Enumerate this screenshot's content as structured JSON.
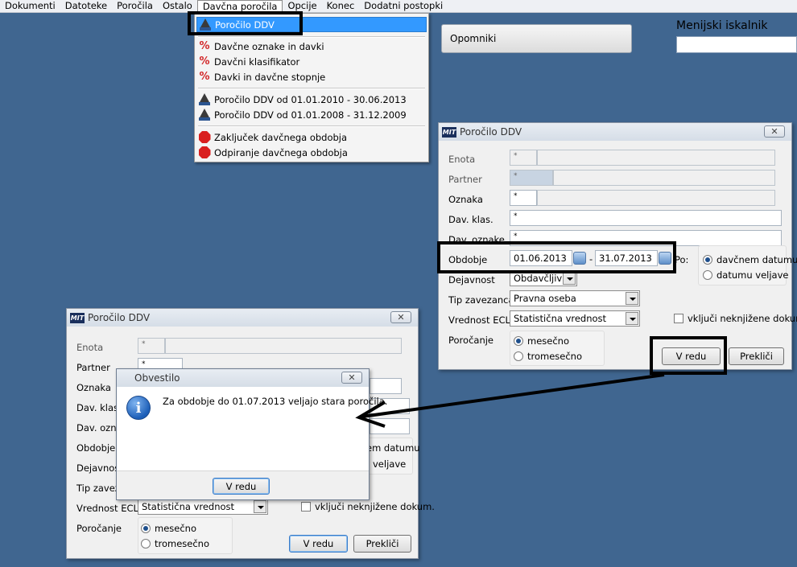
{
  "menu": {
    "items": [
      {
        "label": "Dokumenti"
      },
      {
        "label": "Datoteke"
      },
      {
        "label": "Poročila"
      },
      {
        "label": "Ostalo"
      },
      {
        "label": "Davčna poročila"
      },
      {
        "label": "Opcije"
      },
      {
        "label": "Konec"
      },
      {
        "label": "Dodatni postopki"
      }
    ]
  },
  "dropdown": {
    "items": [
      {
        "label": "Poročilo DDV",
        "icon": "durs-icon"
      },
      {
        "label": "Davčne oznake in davki",
        "icon": "percent-icon"
      },
      {
        "label": "Davčni klasifikator",
        "icon": "percent-icon"
      },
      {
        "label": "Davki in davčne stopnje",
        "icon": "percent-icon"
      },
      {
        "label": "Poročilo DDV od 01.01.2010 - 30.06.2013",
        "icon": "durs-icon"
      },
      {
        "label": "Poročilo DDV od 01.01.2008 - 31.12.2009",
        "icon": "durs-icon"
      },
      {
        "label": "Zaključek davčnega obdobja",
        "icon": "stop-icon"
      },
      {
        "label": "Odpiranje davčnega obdobja",
        "icon": "stop-icon"
      }
    ],
    "icon_text": {
      "durs": "DURS",
      "stop": "STOP"
    }
  },
  "opomniki_label": "Opomniki",
  "search": {
    "label": "Menijski iskalnik",
    "value": ""
  },
  "dlg1": {
    "title": "Poročilo DDV",
    "app_icon": "MIT",
    "close": "✕",
    "enota_label": "Enota",
    "enota_value": "*",
    "partner_label": "Partner",
    "partner_value": "*",
    "oznaka_label": "Oznaka",
    "oznaka_value": "*",
    "davklas_label": "Dav. klas.",
    "davklas_value": "*",
    "davoznake_label": "Dav. oznake",
    "davoznake_value": "*",
    "obdobje_label": "Obdobje",
    "date_from": "01.06.2013",
    "date_sep": "-",
    "date_to": "31.07.2013",
    "po_label": "Po:",
    "radio_davcnem": "davčnem datumu",
    "radio_veljave": "datumu veljave",
    "dejavnost_label": "Dejavnost",
    "dejavnost_value": "Obdavčljiva",
    "tip_label": "Tip zavezanca",
    "tip_value": "Pravna oseba",
    "ecl_label": "Vrednost ECL",
    "ecl_value": "Statistična vrednost",
    "vkljuci_label": "vključi neknjižene dokum.",
    "porocanje_label": "Poročanje",
    "radio_mesecno": "mesečno",
    "radio_tromesecno": "tromesečno",
    "ok_label": "V redu",
    "cancel_label": "Prekliči"
  },
  "dlg2": {
    "title": "Poročilo DDV",
    "app_icon": "MIT",
    "close": "✕",
    "enota_label": "Enota",
    "enota_value": "*",
    "partner_label": "Partner",
    "partner_value": "*",
    "oznaka_label": "Oznaka",
    "davklas_label": "Dav. klas.",
    "davoznake_label": "Dav. ozna",
    "obdobje_label": "Obdobje",
    "dejavnost_label": "Dejavnost",
    "tip_label": "Tip zaveza",
    "radio_davcnem_partial": "em datumu",
    "radio_veljave_partial": "veljave",
    "ecl_label": "Vrednost ECL",
    "ecl_value": "Statistična vrednost",
    "vkljuci_label": "vključi neknjižene dokum.",
    "porocanje_label": "Poročanje",
    "radio_mesecno": "mesečno",
    "radio_tromesecno": "tromesečno",
    "ok_label": "V redu",
    "cancel_label": "Prekliči"
  },
  "msgbox": {
    "title": "Obvestilo",
    "close": "✕",
    "message": "Za obdobje do 01.07.2013 veljajo stara poročila.",
    "info_glyph": "i",
    "ok_label": "V redu"
  }
}
